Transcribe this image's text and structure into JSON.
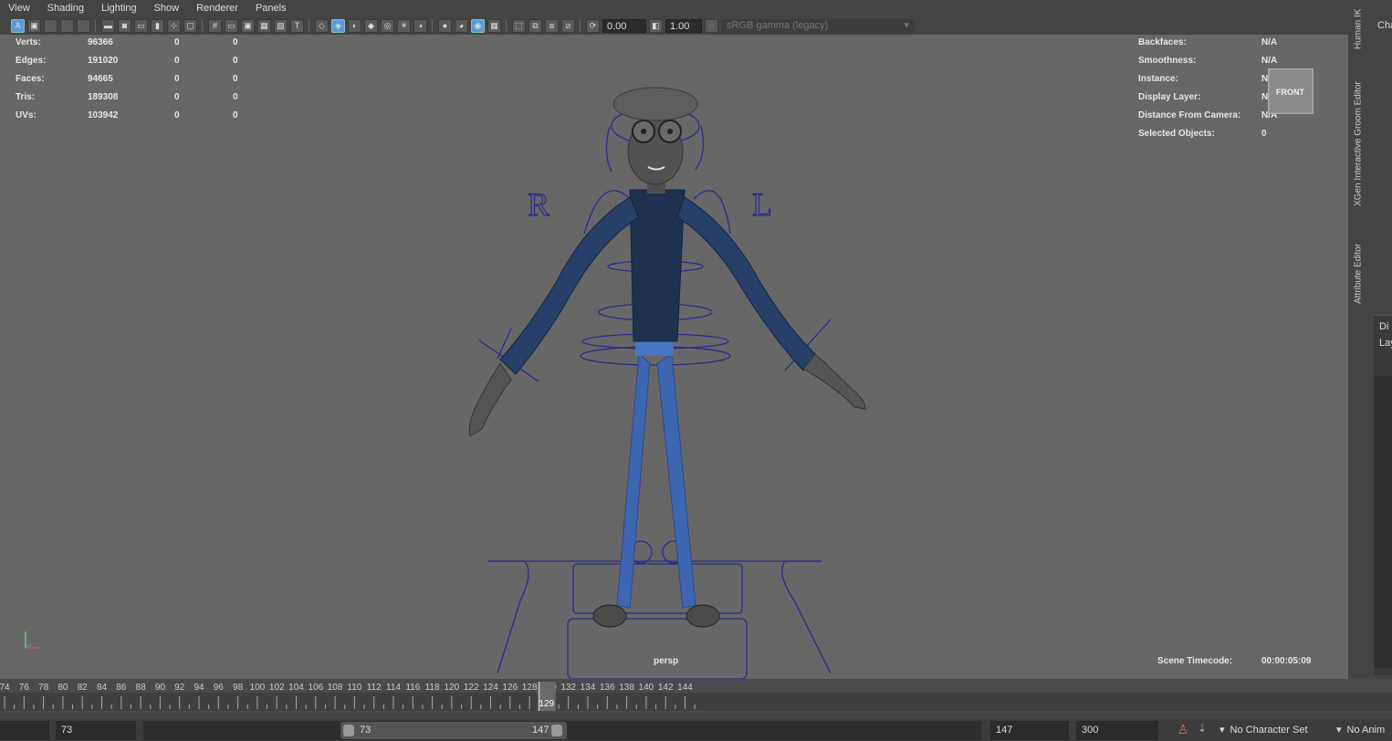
{
  "menu": [
    "View",
    "Shading",
    "Lighting",
    "Show",
    "Renderer",
    "Panels"
  ],
  "toolbar": {
    "exposure_value": "0.00",
    "gamma_value": "1.00",
    "color_management": "sRGB gamma (legacy)"
  },
  "hud_left": {
    "rows": [
      {
        "label": "Verts:",
        "v1": "96366",
        "v2": "0",
        "v3": "0"
      },
      {
        "label": "Edges:",
        "v1": "191020",
        "v2": "0",
        "v3": "0"
      },
      {
        "label": "Faces:",
        "v1": "94665",
        "v2": "0",
        "v3": "0"
      },
      {
        "label": "Tris:",
        "v1": "189308",
        "v2": "0",
        "v3": "0"
      },
      {
        "label": "UVs:",
        "v1": "103942",
        "v2": "0",
        "v3": "0"
      }
    ]
  },
  "hud_right": {
    "rows": [
      {
        "label": "Backfaces:",
        "value": "N/A"
      },
      {
        "label": "Smoothness:",
        "value": "N/A"
      },
      {
        "label": "Instance:",
        "value": "N/A"
      },
      {
        "label": "Display Layer:",
        "value": "N/A"
      },
      {
        "label": "Distance From Camera:",
        "value": "N/A"
      },
      {
        "label": "Selected Objects:",
        "value": "0"
      }
    ]
  },
  "viewcube_label": "FRONT",
  "rig_labels": {
    "right": "R",
    "left": "L"
  },
  "camera_name": "persp",
  "timecode": {
    "label": "Scene Timecode:",
    "value": "00:00:05:09"
  },
  "side_tabs": [
    "Human IK",
    "XGen Interactive Groom Editor",
    "Attribute Editor"
  ],
  "right_panel": {
    "top_label": "Cha",
    "lines": [
      "Di",
      "Lay"
    ]
  },
  "timeline": {
    "ticks": [
      "74",
      "76",
      "78",
      "80",
      "82",
      "84",
      "86",
      "88",
      "90",
      "92",
      "94",
      "96",
      "98",
      "100",
      "102",
      "104",
      "106",
      "108",
      "110",
      "112",
      "114",
      "116",
      "118",
      "120",
      "122",
      "124",
      "126",
      "128",
      "130",
      "132",
      "134",
      "136",
      "138",
      "140",
      "142",
      "144"
    ],
    "current_frame": "129"
  },
  "range": {
    "start": "73",
    "slider_start": "73",
    "slider_end": "147",
    "end": "147",
    "anim_end": "300",
    "character_set": "No Character Set",
    "anim_layer": "No Anim"
  },
  "colors": {
    "viewport_bg": "#676767",
    "rig_blue": "#2a2a8c",
    "current_frame": "#e0e0e0"
  }
}
